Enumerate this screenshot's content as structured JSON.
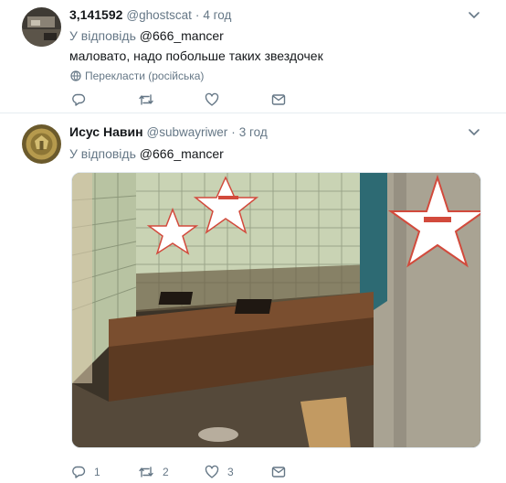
{
  "tweets": [
    {
      "name": "3,141592",
      "handle": "@ghostscat",
      "dot": "·",
      "time": "4 год",
      "reply_prefix": "У відповідь",
      "reply_mention": "@666_mancer",
      "text": "маловато, надо побольше таких звездочек",
      "translate_label": "Перекласти (російська)",
      "actions": {
        "reply": "",
        "retweet": "",
        "like": ""
      }
    },
    {
      "name": "Исус Навин",
      "handle": "@subwayriwer",
      "dot": "·",
      "time": "3 год",
      "reply_prefix": "У відповідь",
      "reply_mention": "@666_mancer",
      "actions": {
        "reply": "1",
        "retweet": "2",
        "like": "3"
      }
    }
  ],
  "colors": {
    "secondary": "#657786",
    "text": "#14171a",
    "border": "#e6ecf0"
  }
}
